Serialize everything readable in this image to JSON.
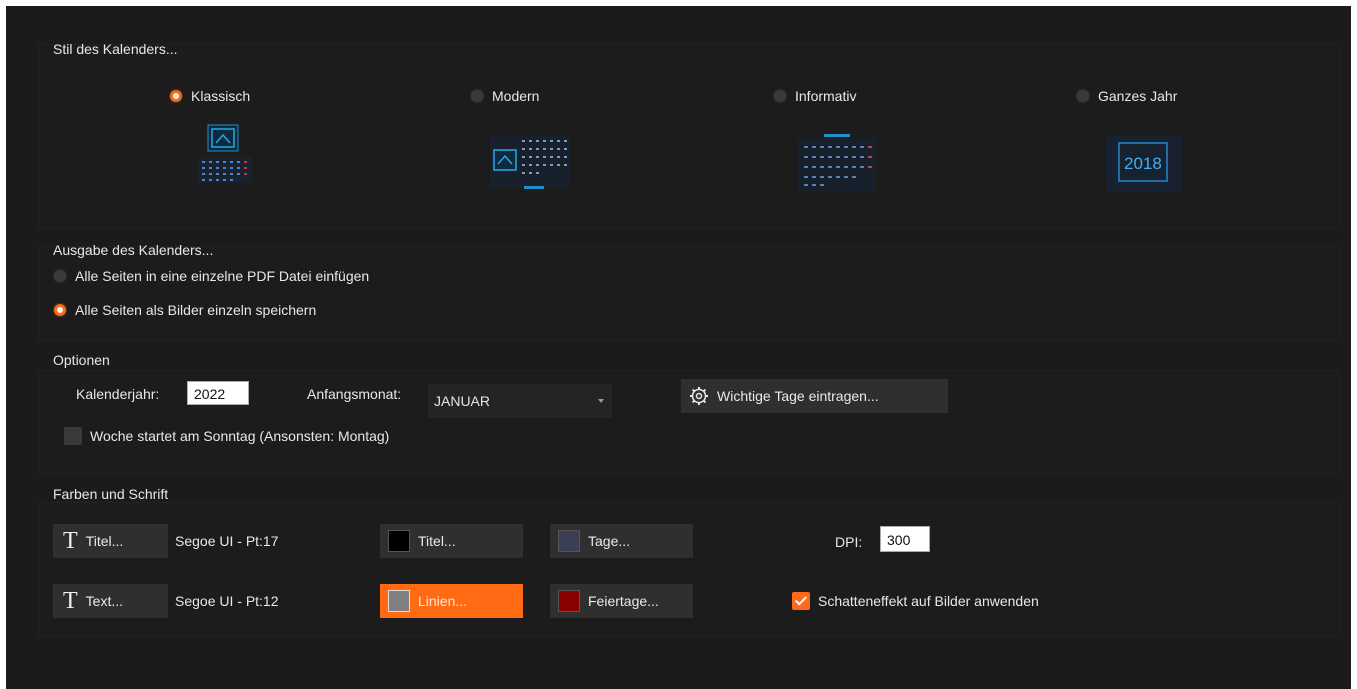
{
  "style_group": {
    "title": "Stil des Kalenders...",
    "options": [
      {
        "label": "Klassisch",
        "selected": true,
        "icon": "calendar-classic-icon"
      },
      {
        "label": "Modern",
        "selected": false,
        "icon": "calendar-modern-icon"
      },
      {
        "label": "Informativ",
        "selected": false,
        "icon": "calendar-informative-icon"
      },
      {
        "label": "Ganzes Jahr",
        "selected": false,
        "icon": "calendar-full-year-icon",
        "icon_text": "2018"
      }
    ]
  },
  "output_group": {
    "title": "Ausgabe des Kalenders...",
    "options": [
      {
        "label": "Alle Seiten in eine einzelne PDF Datei einfügen",
        "selected": false
      },
      {
        "label": "Alle Seiten als Bilder einzeln speichern",
        "selected": true
      }
    ]
  },
  "options_group": {
    "title": "Optionen",
    "year_label": "Kalenderjahr:",
    "year_value": "2022",
    "start_month_label": "Anfangsmonat:",
    "start_month_value": "JANUAR",
    "important_days_button": "Wichtige Tage eintragen...",
    "week_sunday_label": "Woche startet am Sonntag (Ansonsten: Montag)",
    "week_sunday_checked": false
  },
  "colors_group": {
    "title": "Farben und Schrift",
    "title_font_button": "Titel...",
    "title_font_info": "Segoe UI - Pt:17",
    "text_font_button": "Text...",
    "text_font_info": "Segoe UI - Pt:12",
    "title_color_button": "Titel...",
    "title_color": "#000000",
    "lines_color_button": "Linien...",
    "lines_color": "#808080",
    "days_color_button": "Tage...",
    "days_color": "#3b3f55",
    "holidays_color_button": "Feiertage...",
    "holidays_color": "#8b0000",
    "dpi_label": "DPI:",
    "dpi_value": "300",
    "shadow_label": "Schatteneffekt auf Bilder anwenden",
    "shadow_checked": true
  },
  "colors": {
    "accent": "#ff6a1a",
    "background": "#1b1b1b",
    "button": "#2f2f2f"
  }
}
